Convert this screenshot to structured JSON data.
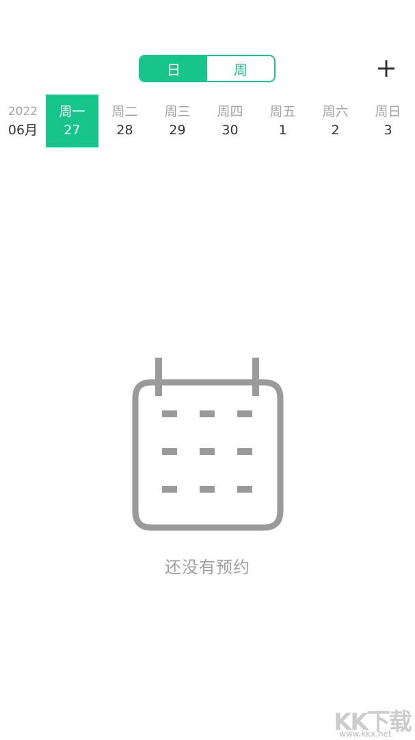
{
  "view_toggle": {
    "day_label": "日",
    "week_label": "周",
    "active": "day"
  },
  "add_button": {
    "icon": "plus-icon"
  },
  "week_strip": {
    "year": "2022",
    "month": "06月",
    "selected_index": 0,
    "days": [
      {
        "weekday": "周一",
        "date": "27"
      },
      {
        "weekday": "周二",
        "date": "28"
      },
      {
        "weekday": "周三",
        "date": "29"
      },
      {
        "weekday": "周四",
        "date": "30"
      },
      {
        "weekday": "周五",
        "date": "1"
      },
      {
        "weekday": "周六",
        "date": "2"
      },
      {
        "weekday": "周日",
        "date": "3"
      }
    ]
  },
  "empty_state": {
    "icon": "calendar-icon",
    "message": "还没有预约"
  },
  "watermark": {
    "main": "KK下载",
    "sub": "www.kkx.net"
  },
  "colors": {
    "accent": "#17c48a",
    "muted_text": "#a4a4a4",
    "icon_gray": "#9a9a9a"
  }
}
